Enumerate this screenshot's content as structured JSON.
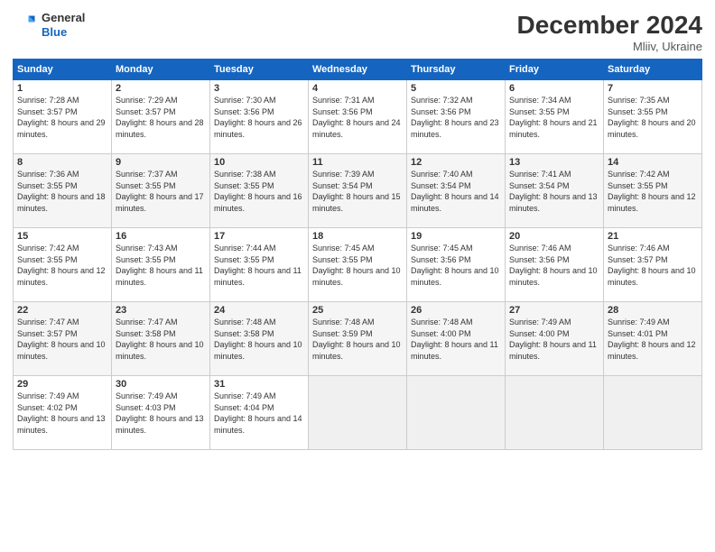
{
  "header": {
    "logo_general": "General",
    "logo_blue": "Blue",
    "month_year": "December 2024",
    "location": "Mliiv, Ukraine"
  },
  "weekdays": [
    "Sunday",
    "Monday",
    "Tuesday",
    "Wednesday",
    "Thursday",
    "Friday",
    "Saturday"
  ],
  "weeks": [
    [
      {
        "day": "1",
        "sunrise": "7:28 AM",
        "sunset": "3:57 PM",
        "daylight": "8 hours and 29 minutes."
      },
      {
        "day": "2",
        "sunrise": "7:29 AM",
        "sunset": "3:57 PM",
        "daylight": "8 hours and 28 minutes."
      },
      {
        "day": "3",
        "sunrise": "7:30 AM",
        "sunset": "3:56 PM",
        "daylight": "8 hours and 26 minutes."
      },
      {
        "day": "4",
        "sunrise": "7:31 AM",
        "sunset": "3:56 PM",
        "daylight": "8 hours and 24 minutes."
      },
      {
        "day": "5",
        "sunrise": "7:32 AM",
        "sunset": "3:56 PM",
        "daylight": "8 hours and 23 minutes."
      },
      {
        "day": "6",
        "sunrise": "7:34 AM",
        "sunset": "3:55 PM",
        "daylight": "8 hours and 21 minutes."
      },
      {
        "day": "7",
        "sunrise": "7:35 AM",
        "sunset": "3:55 PM",
        "daylight": "8 hours and 20 minutes."
      }
    ],
    [
      {
        "day": "8",
        "sunrise": "7:36 AM",
        "sunset": "3:55 PM",
        "daylight": "8 hours and 18 minutes."
      },
      {
        "day": "9",
        "sunrise": "7:37 AM",
        "sunset": "3:55 PM",
        "daylight": "8 hours and 17 minutes."
      },
      {
        "day": "10",
        "sunrise": "7:38 AM",
        "sunset": "3:55 PM",
        "daylight": "8 hours and 16 minutes."
      },
      {
        "day": "11",
        "sunrise": "7:39 AM",
        "sunset": "3:54 PM",
        "daylight": "8 hours and 15 minutes."
      },
      {
        "day": "12",
        "sunrise": "7:40 AM",
        "sunset": "3:54 PM",
        "daylight": "8 hours and 14 minutes."
      },
      {
        "day": "13",
        "sunrise": "7:41 AM",
        "sunset": "3:54 PM",
        "daylight": "8 hours and 13 minutes."
      },
      {
        "day": "14",
        "sunrise": "7:42 AM",
        "sunset": "3:55 PM",
        "daylight": "8 hours and 12 minutes."
      }
    ],
    [
      {
        "day": "15",
        "sunrise": "7:42 AM",
        "sunset": "3:55 PM",
        "daylight": "8 hours and 12 minutes."
      },
      {
        "day": "16",
        "sunrise": "7:43 AM",
        "sunset": "3:55 PM",
        "daylight": "8 hours and 11 minutes."
      },
      {
        "day": "17",
        "sunrise": "7:44 AM",
        "sunset": "3:55 PM",
        "daylight": "8 hours and 11 minutes."
      },
      {
        "day": "18",
        "sunrise": "7:45 AM",
        "sunset": "3:55 PM",
        "daylight": "8 hours and 10 minutes."
      },
      {
        "day": "19",
        "sunrise": "7:45 AM",
        "sunset": "3:56 PM",
        "daylight": "8 hours and 10 minutes."
      },
      {
        "day": "20",
        "sunrise": "7:46 AM",
        "sunset": "3:56 PM",
        "daylight": "8 hours and 10 minutes."
      },
      {
        "day": "21",
        "sunrise": "7:46 AM",
        "sunset": "3:57 PM",
        "daylight": "8 hours and 10 minutes."
      }
    ],
    [
      {
        "day": "22",
        "sunrise": "7:47 AM",
        "sunset": "3:57 PM",
        "daylight": "8 hours and 10 minutes."
      },
      {
        "day": "23",
        "sunrise": "7:47 AM",
        "sunset": "3:58 PM",
        "daylight": "8 hours and 10 minutes."
      },
      {
        "day": "24",
        "sunrise": "7:48 AM",
        "sunset": "3:58 PM",
        "daylight": "8 hours and 10 minutes."
      },
      {
        "day": "25",
        "sunrise": "7:48 AM",
        "sunset": "3:59 PM",
        "daylight": "8 hours and 10 minutes."
      },
      {
        "day": "26",
        "sunrise": "7:48 AM",
        "sunset": "4:00 PM",
        "daylight": "8 hours and 11 minutes."
      },
      {
        "day": "27",
        "sunrise": "7:49 AM",
        "sunset": "4:00 PM",
        "daylight": "8 hours and 11 minutes."
      },
      {
        "day": "28",
        "sunrise": "7:49 AM",
        "sunset": "4:01 PM",
        "daylight": "8 hours and 12 minutes."
      }
    ],
    [
      {
        "day": "29",
        "sunrise": "7:49 AM",
        "sunset": "4:02 PM",
        "daylight": "8 hours and 13 minutes."
      },
      {
        "day": "30",
        "sunrise": "7:49 AM",
        "sunset": "4:03 PM",
        "daylight": "8 hours and 13 minutes."
      },
      {
        "day": "31",
        "sunrise": "7:49 AM",
        "sunset": "4:04 PM",
        "daylight": "8 hours and 14 minutes."
      },
      null,
      null,
      null,
      null
    ]
  ]
}
